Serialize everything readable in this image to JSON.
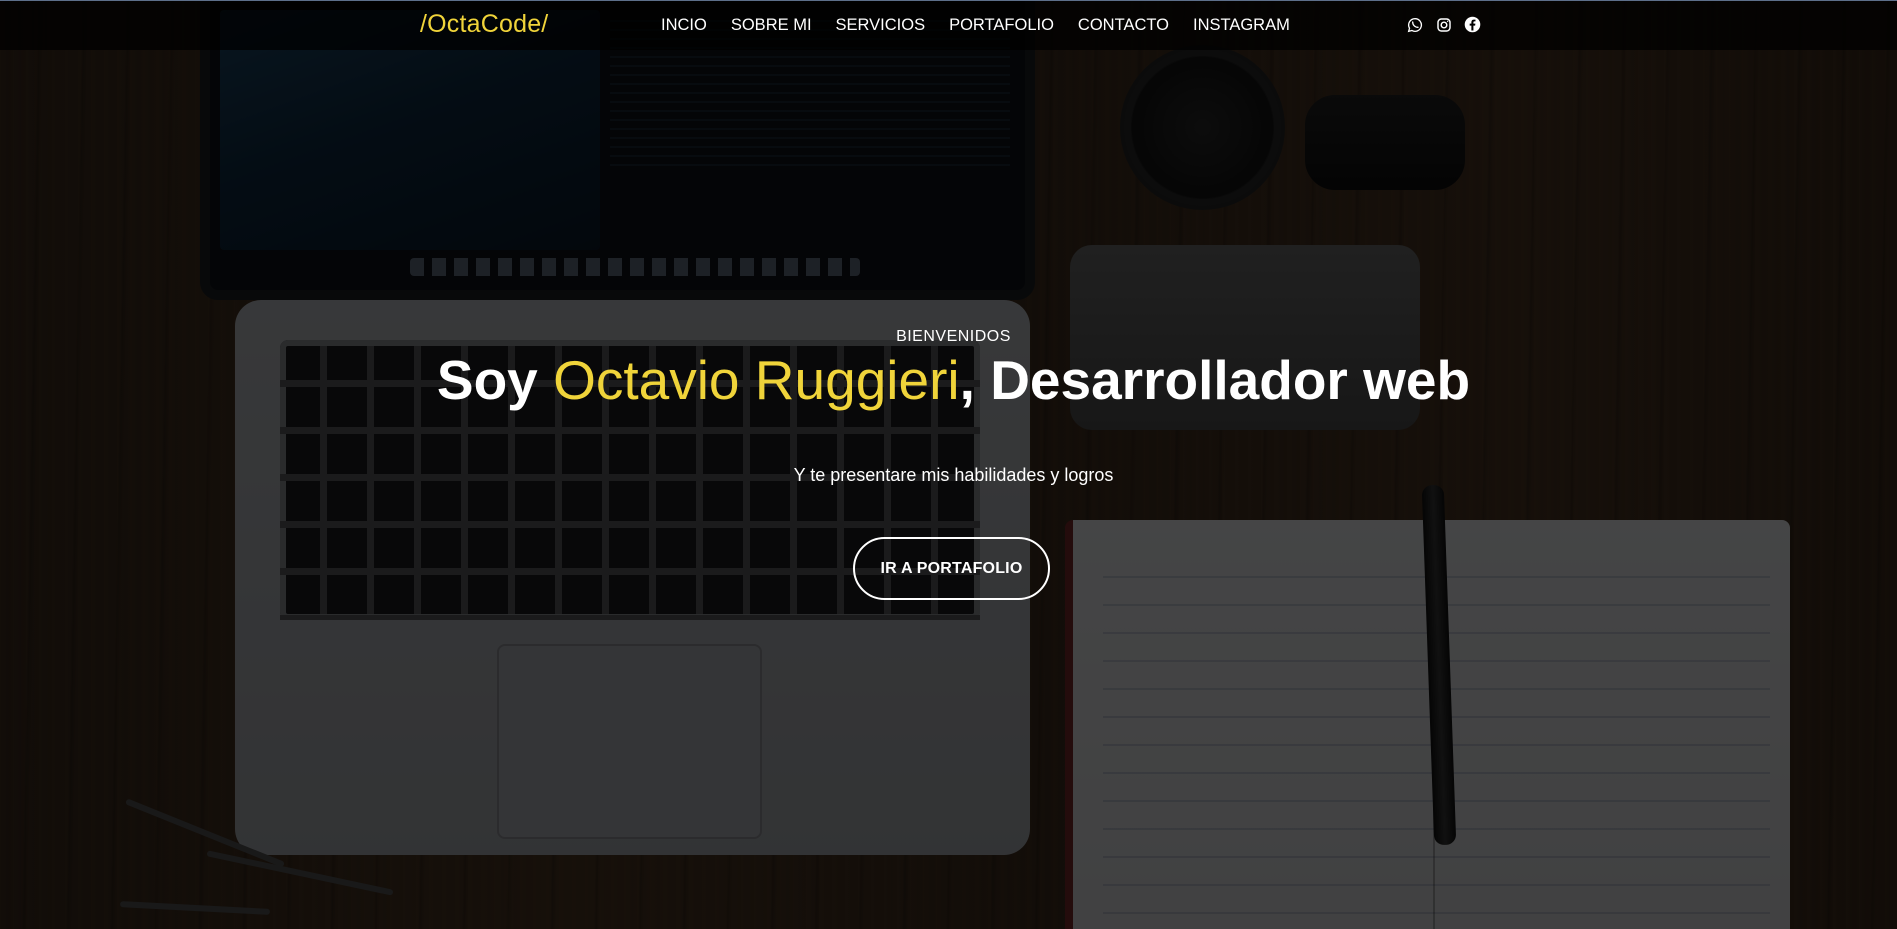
{
  "brand": {
    "logo_text": "/OctaCode/",
    "color": "#f0d43a"
  },
  "nav": {
    "links": [
      {
        "label": "INCIO"
      },
      {
        "label": "SOBRE MI"
      },
      {
        "label": "SERVICIOS"
      },
      {
        "label": "PORTAFOLIO"
      },
      {
        "label": "CONTACTO"
      },
      {
        "label": "INSTAGRAM"
      }
    ],
    "socials": [
      {
        "icon": "whatsapp-icon"
      },
      {
        "icon": "instagram-icon"
      },
      {
        "icon": "facebook-icon"
      }
    ]
  },
  "hero": {
    "kicker": "BIENVENIDOS",
    "headline_prefix": "Soy ",
    "headline_name": "Octavio Ruggieri",
    "headline_suffix": ", Desarrollador web",
    "subtitle": "Y te presentare mis habilidades y logros",
    "cta_label": "IR A PORTAFOLIO",
    "accent_color": "#f0d43a"
  }
}
